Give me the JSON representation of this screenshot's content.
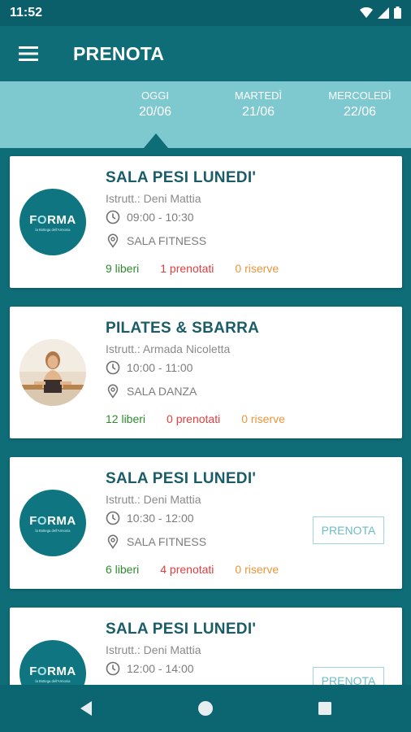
{
  "status_bar": {
    "time": "11:52"
  },
  "app_bar": {
    "title": "PRENOTA"
  },
  "days": [
    {
      "name": "OGGI",
      "date": "20/06"
    },
    {
      "name": "MARTEDÌ",
      "date": "21/06"
    },
    {
      "name": "MERCOLEDÌ",
      "date": "22/06"
    }
  ],
  "logo": {
    "text_pre": "F",
    "text_post": "RMA",
    "tagline": "la Bottega dell'Armonia"
  },
  "cards": [
    {
      "title": "SALA PESI LUNEDI'",
      "instructor": "Istrutt.: Deni Mattia",
      "time": "09:00 - 10:30",
      "room": "SALA FITNESS",
      "free": "9 liberi",
      "booked": "1 prenotati",
      "reserves": "0 riserve",
      "avatar": "logo"
    },
    {
      "title": "PILATES & SBARRA",
      "instructor": "Istrutt.: Armada Nicoletta",
      "time": "10:00 - 11:00",
      "room": "SALA DANZA",
      "free": "12 liberi",
      "booked": "0 prenotati",
      "reserves": "0 riserve",
      "avatar": "photo"
    },
    {
      "title": "SALA PESI LUNEDI'",
      "instructor": "Istrutt.: Deni Mattia",
      "time": "10:30 - 12:00",
      "room": "SALA FITNESS",
      "free": "6 liberi",
      "booked": "4 prenotati",
      "reserves": "0 riserve",
      "avatar": "logo",
      "button": "PRENOTA"
    },
    {
      "title": "SALA PESI LUNEDI'",
      "instructor": "Istrutt.: Deni Mattia",
      "time": "12:00 - 14:00",
      "avatar": "logo",
      "button": "PRENOTA"
    }
  ],
  "colors": {
    "primary": "#0f6d78",
    "strip": "#7ec9cf",
    "title": "#1a5d68",
    "free": "#2f8a2f",
    "booked": "#e03e3e",
    "reserves": "#e8963a"
  },
  "icons": {
    "menu": "menu-icon",
    "clock": "clock-icon",
    "location": "location-pin-icon",
    "back": "back-icon",
    "home": "home-icon",
    "recents": "recents-icon"
  }
}
